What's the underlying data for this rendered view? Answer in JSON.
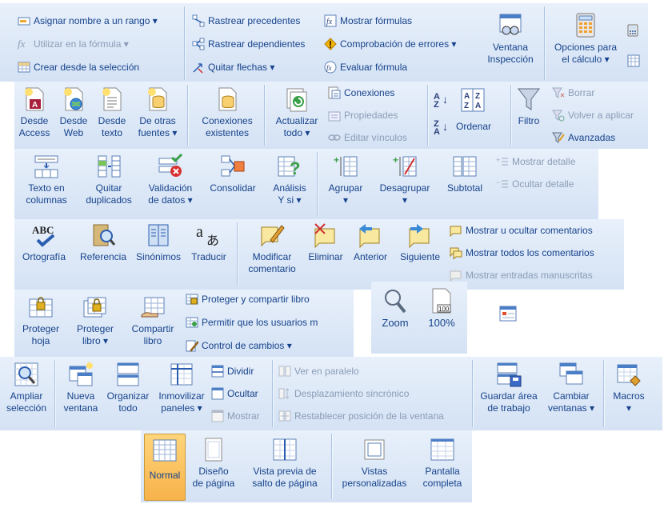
{
  "row1": {
    "nombres": {
      "asignar": "Asignar nombre a un rango ▾",
      "utilizar": "Utilizar en la fórmula ▾",
      "crear": "Crear desde la selección"
    },
    "auditoria": {
      "rastrear_prec": "Rastrear precedentes",
      "rastrear_dep": "Rastrear dependientes",
      "quitar": "Quitar flechas ▾",
      "mostrar_formulas": "Mostrar fórmulas",
      "comprobacion": "Comprobación de errores ▾",
      "evaluar": "Evaluar fórmula",
      "ventana_l1": "Ventana",
      "ventana_l2": "Inspección"
    },
    "calculo": {
      "opciones_l1": "Opciones para",
      "opciones_l2": "el cálculo ▾"
    }
  },
  "row2": {
    "externos": {
      "access_l1": "Desde",
      "access_l2": "Access",
      "web_l1": "Desde",
      "web_l2": "Web",
      "texto_l1": "Desde",
      "texto_l2": "texto",
      "otras_l1": "De otras",
      "otras_l2": "fuentes ▾",
      "existentes_l1": "Conexiones",
      "existentes_l2": "existentes"
    },
    "conexiones": {
      "actualizar_l1": "Actualizar",
      "actualizar_l2": "todo ▾",
      "conexiones": "Conexiones",
      "propiedades": "Propiedades",
      "editar": "Editar vínculos"
    },
    "ordenar": {
      "ordenar": "Ordenar",
      "filtro": "Filtro",
      "borrar": "Borrar",
      "volver": "Volver a aplicar",
      "avanzadas": "Avanzadas"
    }
  },
  "row3": {
    "herramientas": {
      "texto_l1": "Texto en",
      "texto_l2": "columnas",
      "quitar_l1": "Quitar",
      "quitar_l2": "duplicados",
      "validacion_l1": "Validación",
      "validacion_l2": "de datos ▾",
      "consolidar": "Consolidar",
      "analisis_l1": "Análisis",
      "analisis_l2": "Y si ▾"
    },
    "esquema": {
      "agrupar": "Agrupar",
      "desagrupar": "Desagrupar",
      "subtotal": "Subtotal",
      "mostrar_detalle": "Mostrar detalle",
      "ocultar_detalle": "Ocultar detalle"
    }
  },
  "row4": {
    "revision": {
      "ortografia": "Ortografía",
      "referencia": "Referencia",
      "sinonimos": "Sinónimos",
      "traducir": "Traducir"
    },
    "comentarios": {
      "modificar_l1": "Modificar",
      "modificar_l2": "comentario",
      "eliminar": "Eliminar",
      "anterior": "Anterior",
      "siguiente": "Siguiente",
      "mostrar_ocultar": "Mostrar u ocultar comentarios",
      "mostrar_todos": "Mostrar todos los comentarios",
      "mostrar_entradas": "Mostrar entradas manuscritas"
    }
  },
  "row5": {
    "cambios": {
      "proteger_hoja_l1": "Proteger",
      "proteger_hoja_l2": "hoja",
      "proteger_libro_l1": "Proteger",
      "proteger_libro_l2": "libro ▾",
      "compartir_l1": "Compartir",
      "compartir_l2": "libro",
      "proteger_compartir": "Proteger y compartir libro",
      "permitir": "Permitir que los usuarios m",
      "control": "Control de cambios ▾"
    },
    "zoom": {
      "zoom": "Zoom",
      "cien": "100%",
      "cien_icon": "100"
    }
  },
  "row6": {
    "ampliar_l1": "Ampliar",
    "ampliar_l2": "selección",
    "nueva_l1": "Nueva",
    "nueva_l2": "ventana",
    "organizar_l1": "Organizar",
    "organizar_l2": "todo",
    "inmovilizar_l1": "Inmovilizar",
    "inmovilizar_l2": "paneles ▾",
    "dividir": "Dividir",
    "ocultar": "Ocultar",
    "mostrar": "Mostrar",
    "paralelo": "Ver en paralelo",
    "desplazamiento": "Desplazamiento sincrónico",
    "restablecer": "Restablecer posición de la ventana",
    "guardar_l1": "Guardar área",
    "guardar_l2": "de trabajo",
    "cambiar_l1": "Cambiar",
    "cambiar_l2": "ventanas ▾",
    "macros_l1": "Macros",
    "macros_l2": "▾"
  },
  "row7": {
    "normal": "Normal",
    "diseno_l1": "Diseño",
    "diseno_l2": "de página",
    "previa_l1": "Vista previa de",
    "previa_l2": "salto de página",
    "vistas_l1": "Vistas",
    "vistas_l2": "personalizadas",
    "pantalla_l1": "Pantalla",
    "pantalla_l2": "completa"
  }
}
